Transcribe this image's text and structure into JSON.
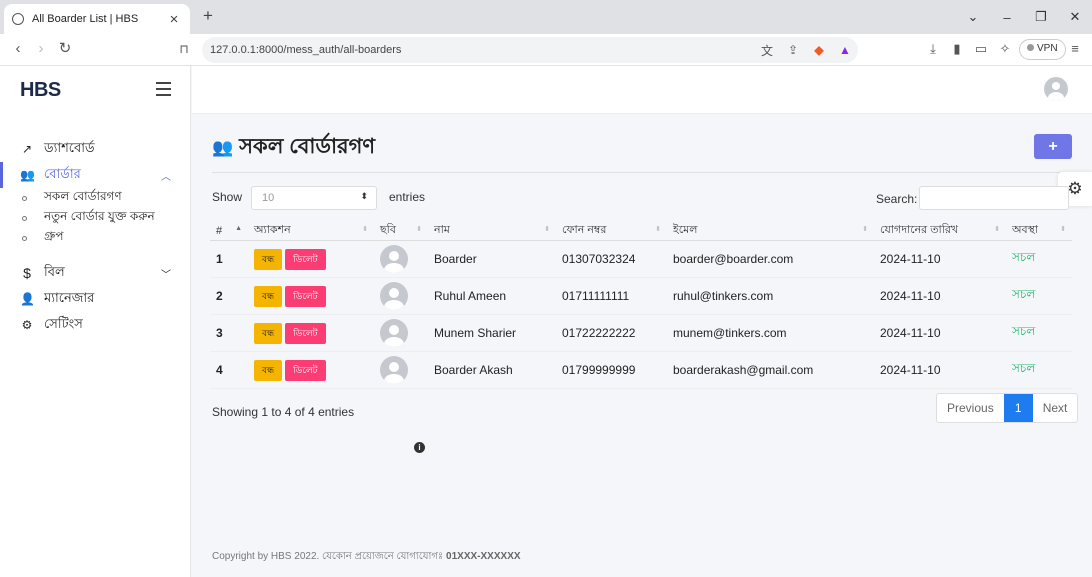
{
  "browser": {
    "tab_title": "All Boarder List | HBS",
    "url": "127.0.0.1:8000/mess_auth/all-boarders",
    "vpn_label": "VPN"
  },
  "sidebar": {
    "brand": "HBS",
    "items": [
      {
        "label": "ড্যাশবোর্ড",
        "icon": "trend-icon"
      },
      {
        "label": "বোর্ডার",
        "icon": "users-icon",
        "active": true
      },
      {
        "label": "বিল",
        "icon": "dollar-icon"
      },
      {
        "label": "ম্যানেজার",
        "icon": "user-check-icon"
      },
      {
        "label": "সেটিংস",
        "icon": "gear-icon"
      }
    ],
    "submenu": [
      "সকল বোর্ডারগণ",
      "নতুন বোর্ডার যুক্ত করুন",
      "গ্রুপ"
    ]
  },
  "page": {
    "title": "সকল বোর্ডারগণ",
    "add_label": "+"
  },
  "table_controls": {
    "show_label": "Show",
    "page_size": "10",
    "entries_label": "entries",
    "search_label": "Search:"
  },
  "table": {
    "headers": [
      "#",
      "অ্যাকশন",
      "ছবি",
      "নাম",
      "ফোন নম্বর",
      "ইমেল",
      "যোগদানের তারিখ",
      "অবস্থা"
    ],
    "edit_label": "বন্ধ",
    "delete_label": "ডিলেট",
    "rows": [
      {
        "idx": "1",
        "name": "Boarder",
        "phone": "01307032324",
        "email": "boarder@boarder.com",
        "date": "2024-11-10",
        "status": "সচল"
      },
      {
        "idx": "2",
        "name": "Ruhul Ameen",
        "phone": "01711111111",
        "email": "ruhul@tinkers.com",
        "date": "2024-11-10",
        "status": "সচল"
      },
      {
        "idx": "3",
        "name": "Munem Sharier",
        "phone": "01722222222",
        "email": "munem@tinkers.com",
        "date": "2024-11-10",
        "status": "সচল"
      },
      {
        "idx": "4",
        "name": "Boarder Akash",
        "phone": "01799999999",
        "email": "boarderakash@gmail.com",
        "date": "2024-11-10",
        "status": "সচল"
      }
    ]
  },
  "pagination": {
    "info": "Showing 1 to 4 of 4 entries",
    "prev": "Previous",
    "current": "1",
    "next": "Next"
  },
  "footer": {
    "text": "Copyright by HBS 2022. যেকোন প্রয়োজনে যোগাযোগঃ ",
    "contact": "01XXX-XXXXXX"
  },
  "colors": {
    "accent": "#5867dd",
    "add_button": "#6f76e6",
    "status": "#1fb56a",
    "page_active": "#1f7cf0"
  }
}
